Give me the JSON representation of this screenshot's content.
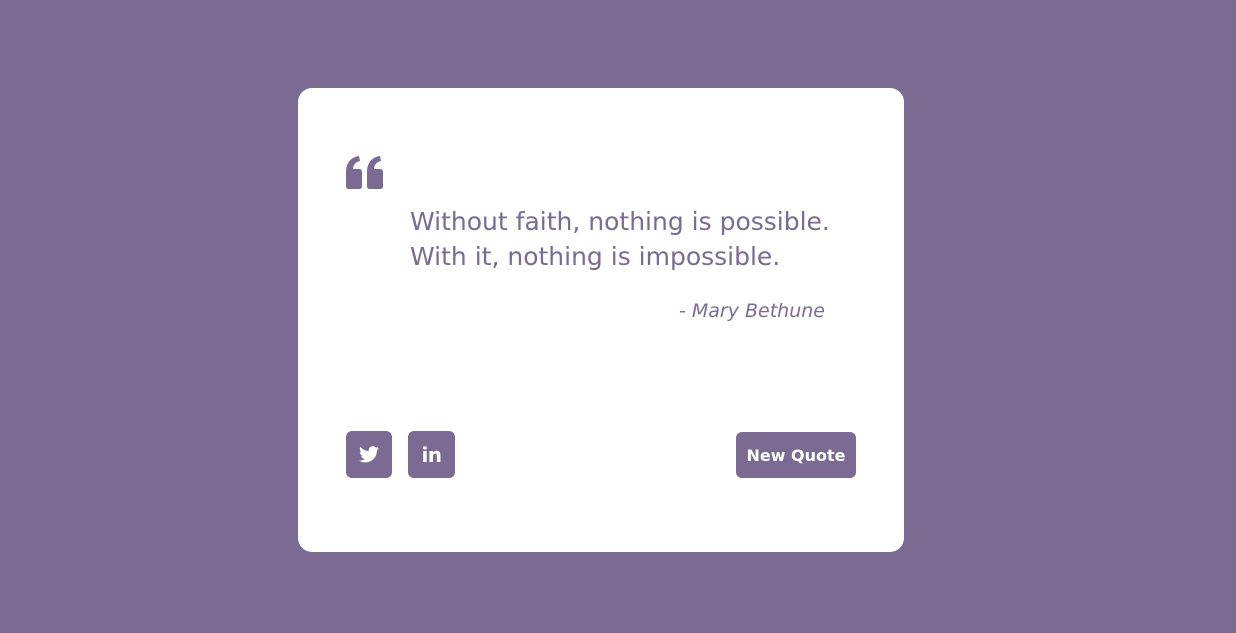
{
  "quote": {
    "line1": "Without faith, nothing is possible.",
    "line2": "With it, nothing is impossible.",
    "author": "- Mary Bethune"
  },
  "actions": {
    "new_quote_label": "New Quote",
    "twitter_icon": "twitter-icon",
    "linkedin_icon": "linkedin-icon",
    "linkedin_glyph": "in"
  },
  "colors": {
    "background": "#7b6b92",
    "card": "#ffffff",
    "accent": "#7b6b92"
  }
}
